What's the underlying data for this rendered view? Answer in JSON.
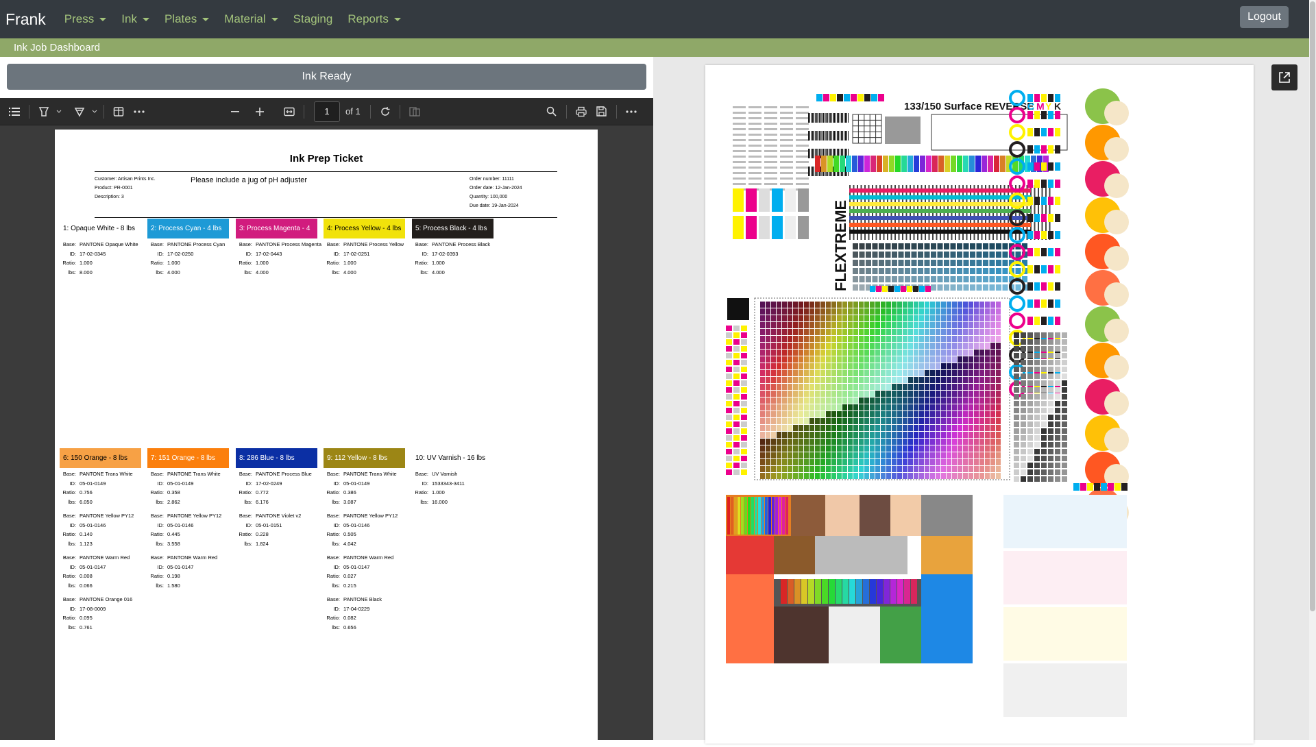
{
  "nav": {
    "brand": "Frank",
    "items": [
      {
        "label": "Press",
        "dropdown": true
      },
      {
        "label": "Ink",
        "dropdown": true
      },
      {
        "label": "Plates",
        "dropdown": true
      },
      {
        "label": "Material",
        "dropdown": true
      },
      {
        "label": "Staging",
        "dropdown": false
      },
      {
        "label": "Reports",
        "dropdown": true
      }
    ],
    "logout": "Logout"
  },
  "subbar": {
    "title": "Ink Job Dashboard"
  },
  "status_button": "Ink Ready",
  "pdf_toolbar": {
    "page_current": "1",
    "page_of": "of 1"
  },
  "ticket": {
    "title": "Ink Prep Ticket",
    "customer": "Customer:  Artisan Prints Inc.",
    "product": "Product:  PR-0001",
    "description": "Description:  3",
    "note": "Please include a jug of pH adjuster",
    "order_number": "Order number:  11111",
    "order_date": "Order date:  12-Jan-2024",
    "quantity": "Quantity:  100,000",
    "due_date": "Due date:  19-Jan-2024"
  },
  "inks": [
    {
      "title": "1:  Opaque White - 8 lbs",
      "color": "#ffffff",
      "text_color": "#000000",
      "bases": [
        {
          "base": "PANTONE Opaque White",
          "id": "17-02-0345",
          "ratio": "1.000",
          "lbs": "8.000"
        }
      ]
    },
    {
      "title": "2:  Process Cyan - 4 lbs",
      "color": "#1e9ad6",
      "text_color": "#ffffff",
      "bases": [
        {
          "base": "PANTONE Process Cyan",
          "id": "17-02-0250",
          "ratio": "1.000",
          "lbs": "4.000"
        }
      ]
    },
    {
      "title": "3:  Process Magenta - 4 lbs",
      "color": "#d11c7e",
      "text_color": "#ffffff",
      "bases": [
        {
          "base": "PANTONE Process Magenta",
          "id": "17-02-0443",
          "ratio": "1.000",
          "lbs": "4.000"
        }
      ]
    },
    {
      "title": "4:  Process Yellow - 4 lbs",
      "color": "#f1e20b",
      "text_color": "#000000",
      "bases": [
        {
          "base": "PANTONE Process Yellow",
          "id": "17-02-0251",
          "ratio": "1.000",
          "lbs": "4.000"
        }
      ]
    },
    {
      "title": "5:  Process Black - 4 lbs",
      "color": "#231f1c",
      "text_color": "#ffffff",
      "bases": [
        {
          "base": "PANTONE Process Black",
          "id": "17-02-0393",
          "ratio": "1.000",
          "lbs": "4.000"
        }
      ]
    },
    {
      "title": "6:  150 Orange - 8 lbs",
      "color": "#f7a145",
      "text_color": "#000000",
      "bases": [
        {
          "base": "PANTONE Trans White",
          "id": "05-01-0149",
          "ratio": "0.756",
          "lbs": "6.050"
        },
        {
          "base": "PANTONE Yellow PY12",
          "id": "05-01-0146",
          "ratio": "0.140",
          "lbs": "1.123"
        },
        {
          "base": "PANTONE Warm Red",
          "id": "05-01-0147",
          "ratio": "0.008",
          "lbs": "0.066"
        },
        {
          "base": "PANTONE Orange 016",
          "id": "17-08-0009",
          "ratio": "0.095",
          "lbs": "0.761"
        }
      ]
    },
    {
      "title": "7:  151 Orange - 8 lbs",
      "color": "#fb7f0d",
      "text_color": "#ffffff",
      "bases": [
        {
          "base": "PANTONE Trans White",
          "id": "05-01-0149",
          "ratio": "0.358",
          "lbs": "2.862"
        },
        {
          "base": "PANTONE Yellow PY12",
          "id": "05-01-0146",
          "ratio": "0.445",
          "lbs": "3.558"
        },
        {
          "base": "PANTONE Warm Red",
          "id": "05-01-0147",
          "ratio": "0.198",
          "lbs": "1.580"
        }
      ]
    },
    {
      "title": "8:  286 Blue - 8 lbs",
      "color": "#0b2fa4",
      "text_color": "#ffffff",
      "bases": [
        {
          "base": "PANTONE Process Blue",
          "id": "17-02-0249",
          "ratio": "0.772",
          "lbs": "6.176"
        },
        {
          "base": "PANTONE Violet v2",
          "id": "05-01-0151",
          "ratio": "0.228",
          "lbs": "1.824"
        }
      ]
    },
    {
      "title": "9:  112 Yellow - 8 lbs",
      "color": "#9c8615",
      "text_color": "#ffffff",
      "bases": [
        {
          "base": "PANTONE Trans White",
          "id": "05-01-0149",
          "ratio": "0.386",
          "lbs": "3.087"
        },
        {
          "base": "PANTONE Yellow PY12",
          "id": "05-01-0146",
          "ratio": "0.505",
          "lbs": "4.042"
        },
        {
          "base": "PANTONE Warm Red",
          "id": "05-01-0147",
          "ratio": "0.027",
          "lbs": "0.215"
        },
        {
          "base": "PANTONE Black",
          "id": "17-04-0229",
          "ratio": "0.082",
          "lbs": "0.656"
        }
      ]
    },
    {
      "title": "10:  UV Varnish - 16 lbs",
      "color": "#ffffff",
      "text_color": "#000000",
      "bases": [
        {
          "base": "UV Varnish",
          "id": "1533343-3411",
          "ratio": "1.000",
          "lbs": "16.000"
        }
      ]
    }
  ],
  "labels": {
    "base": "Base:",
    "id": "ID:",
    "ratio": "Ratio:",
    "lbs": "lbs:"
  },
  "artwork": {
    "heading": "133/150 Surface REVERSE",
    "cmyk": [
      "C",
      "M",
      "Y",
      "K"
    ],
    "logo_text": "FLEXTREME",
    "colors": {
      "cyan": "#00aeef",
      "magenta": "#ec008c",
      "yellow": "#fff200",
      "black": "#231f20"
    }
  },
  "icons": {
    "sidebar": "list-icon",
    "highlight": "highlighter-icon",
    "draw": "draw-icon",
    "layout": "layout-icon",
    "more": "more-icon",
    "zoom_out": "minus-icon",
    "zoom_in": "plus-icon",
    "fit": "fit-width-icon",
    "rotate": "rotate-icon",
    "search": "search-icon",
    "print": "print-icon",
    "save": "save-icon",
    "open_external": "external-link-icon"
  }
}
